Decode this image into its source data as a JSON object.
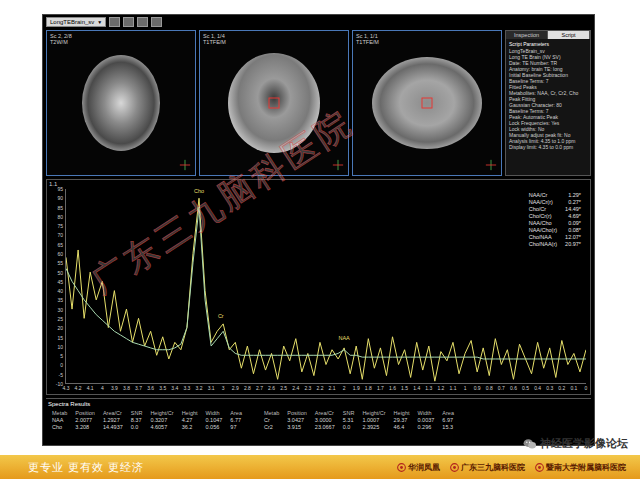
{
  "top_bar": {
    "dropdown": "LongTEBrain_sv",
    "dropdown_icon": "▼"
  },
  "image_panels": [
    {
      "series": "Sc 2, 2/8",
      "sequence": "T2W/M",
      "view": "axial",
      "roi": false
    },
    {
      "series": "Sc 1, 1/4",
      "sequence": "T1TFE/M",
      "view": "coronal",
      "roi": true
    },
    {
      "series": "Sc 1, 1/1",
      "sequence": "T1TFE/M",
      "view": "sagittal",
      "roi": true
    }
  ],
  "side_panel": {
    "tabs": [
      {
        "label": "Inspection",
        "selected": false
      },
      {
        "label": "Script",
        "selected": true
      }
    ],
    "title": "Script Parameters",
    "lines": [
      "LongTeBrain_sv",
      "Long TE Brain (NV SV)",
      "Date: TE Number: TR",
      "Anatomy: brain TE: long",
      "Initial Baseline Subtraction",
      "Baseline Terms: 7",
      "Fitted Peaks",
      "Metabolites: NAA, Cr, Cr2, Cho",
      "Peak Fitting",
      "Gaussian Character: 80",
      "Baseline Terms: 7",
      "Peak: Automatic Peak",
      "Lock Frequencies: Yes",
      "Lock widths: No",
      "Manually adjust peak fit: No",
      "Analysis limit: 4.35 to 1.0 ppm",
      "Display limit: 4.35 to 0.0 ppm"
    ]
  },
  "spectrum": {
    "label": "1.1",
    "y_ticks": [
      "95",
      "90",
      "85",
      "80",
      "75",
      "70",
      "65",
      "60",
      "55",
      "50",
      "45",
      "40",
      "35",
      "30",
      "25",
      "20",
      "15",
      "10",
      "5",
      "0",
      "-5",
      "-10"
    ],
    "x_ticks": [
      "4.3",
      "4.2",
      "4.1",
      "4",
      "3.9",
      "3.8",
      "3.7",
      "3.6",
      "3.5",
      "3.4",
      "3.3",
      "3.2",
      "3.1",
      "3",
      "2.9",
      "2.8",
      "2.7",
      "2.6",
      "2.5",
      "2.4",
      "2.3",
      "2.2",
      "2.1",
      "2",
      "1.9",
      "1.8",
      "1.7",
      "1.6",
      "1.5",
      "1.4",
      "1.3",
      "1.2",
      "1.1",
      "1",
      "0.9",
      "0.8",
      "0.7",
      "0.6",
      "0.5",
      "0.4",
      "0.3",
      "0.2",
      "0.1",
      "0"
    ],
    "series": [
      {
        "name": "measured",
        "color": "#e6df6a",
        "values": [
          58,
          30,
          62,
          25,
          50,
          35,
          45,
          20,
          40,
          18,
          30,
          12,
          25,
          10,
          18,
          5,
          15,
          3,
          12,
          8,
          20,
          60,
          90,
          40,
          12,
          18,
          22,
          8,
          12,
          -2,
          10,
          -5,
          8,
          -3,
          6,
          -8,
          10,
          2,
          14,
          -4,
          6,
          -6,
          12,
          0,
          8,
          3,
          9,
          -5,
          10,
          -8,
          14,
          -2,
          9,
          -6,
          15,
          0,
          8,
          -7,
          12,
          -3,
          10,
          -9,
          7,
          2,
          12,
          -5,
          6,
          13,
          -4,
          9,
          -6,
          14,
          0,
          8,
          -8,
          11,
          3,
          -5,
          12,
          -2,
          9,
          -7,
          13,
          0,
          6,
          -4,
          8
        ]
      },
      {
        "name": "fit",
        "color": "#a9d9b0",
        "values": [
          52,
          45,
          40,
          35,
          31,
          27,
          24,
          21,
          18,
          16,
          14,
          12,
          11,
          10,
          9,
          8,
          8,
          8,
          9,
          11,
          20,
          55,
          85,
          35,
          10,
          14,
          18,
          9,
          6,
          5,
          5,
          5,
          5,
          5,
          5,
          5,
          5,
          5,
          5,
          5,
          5,
          5,
          5,
          5,
          5,
          6,
          8,
          5,
          5,
          4,
          4,
          4,
          4,
          4,
          4,
          4,
          4,
          4,
          4,
          4,
          4,
          4,
          4,
          4,
          4,
          4,
          4,
          4,
          4,
          3,
          3,
          3,
          3,
          3,
          3,
          3,
          3,
          3,
          3,
          3,
          3,
          3,
          3,
          3,
          3,
          3,
          3
        ]
      }
    ],
    "peaks": [
      {
        "label": "Cho",
        "ppm": 3.2,
        "value": 92
      },
      {
        "label": "Cr",
        "ppm": 3.02,
        "value": 24
      },
      {
        "label": "NAA",
        "ppm": 2.0,
        "value": 12
      }
    ],
    "ratios": [
      {
        "label": "NAA/Cr",
        "value": "1.29*"
      },
      {
        "label": "NAA/Cr(r)",
        "value": "0.27*"
      },
      {
        "label": "Cho/Cr",
        "value": "14.49*"
      },
      {
        "label": "Cho/Cr(r)",
        "value": "4.69*"
      },
      {
        "label": "NAA/Cho",
        "value": "0.09*"
      },
      {
        "label": "NAA/Cho(r)",
        "value": "0.08*"
      },
      {
        "label": "Cho/NAA",
        "value": "12.07*"
      },
      {
        "label": "Cho/NAA(r)",
        "value": "20.97*"
      }
    ]
  },
  "results": {
    "title": "Spectra Results",
    "columns": [
      "Metab",
      "Position",
      "Area/Cr",
      "SNR",
      "Height/Cr",
      "Height",
      "Width",
      "Area"
    ],
    "tables": [
      {
        "rows": [
          [
            "NAA",
            "2.0077",
            "1.2927",
            "8.37",
            "0.3207",
            "4.27",
            "0.1047",
            "6.77"
          ],
          [
            "Cho",
            "3.208",
            "14.4937",
            "0.0",
            "4.6057",
            "36.2",
            "0.056",
            "97"
          ]
        ]
      },
      {
        "rows": [
          [
            "Cr",
            "3.0427",
            "3.0000",
            "5.31",
            "1.0007",
            "29.37",
            "0.0037",
            "6.97"
          ],
          [
            "Cr2",
            "3.915",
            "23.0667",
            "0.0",
            "2.3925",
            "46.4",
            "0.296",
            "15.3"
          ]
        ]
      }
    ]
  },
  "watermark": "广东三九脑科医院",
  "wechat_tag": "神经医学影像论坛",
  "footer": {
    "slogan": "更专业 更有效 更经济",
    "logos": [
      "华润凤凰",
      "广东三九脑科医院",
      "暨南大学附属脑科医院"
    ]
  }
}
